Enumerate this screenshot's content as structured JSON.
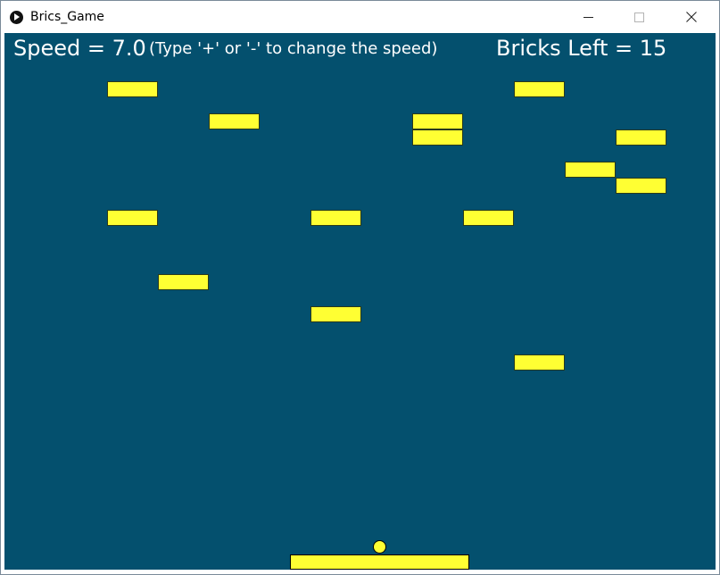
{
  "window": {
    "title": "Brics_Game"
  },
  "hud": {
    "speed": "Speed = 7.0",
    "hint": "(Type '+' or '-' to change the speed)",
    "bricks_left": "Bricks Left = 15"
  },
  "colors": {
    "background": "#04506e",
    "brick": "#ffff33",
    "text": "#ffffff"
  },
  "icons": {
    "app": "play-circle-icon",
    "minimize": "minimize-icon",
    "maximize": "maximize-icon",
    "close": "close-icon"
  }
}
